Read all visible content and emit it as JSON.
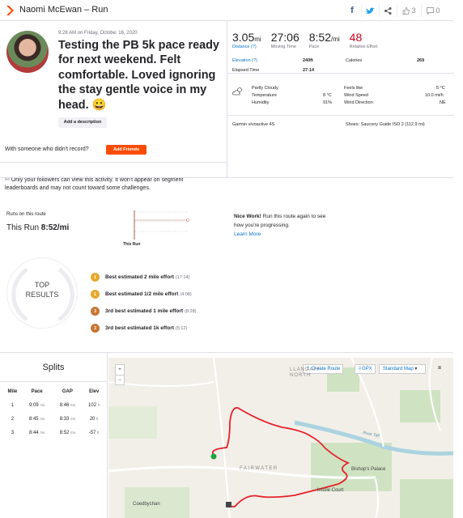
{
  "header": {
    "title": "Naomi McEwan – Run",
    "kudos_count": "3",
    "comment_count": "0"
  },
  "activity": {
    "meta": "9:28 AM on Friday, Octobe: 16, 2020",
    "title": "Testing the PB 5k pace ready for next weekend. Felt comfortable. Loved ignoring the stay gentle voice in my head.",
    "emoji": "😀",
    "add_description_label": "Add a description",
    "with_someone_text": "With someone who didn't record?",
    "add_friends_label": "Add Friends",
    "privacy_text": "Only your followers can view this activity. It won't appear on segment leaderboards and may not count toward some challenges."
  },
  "stats": {
    "distance_value": "3.05",
    "distance_unit": "mi",
    "distance_label": "Distance (?)",
    "moving_time_value": "27:06",
    "moving_time_label": "Moving Time",
    "pace_value": "8:52",
    "pace_unit": "/mi",
    "pace_label": "Pace",
    "relative_effort_value": "48",
    "relative_effort_label": "Relative Effort",
    "elevation_label": "Elevation (?)",
    "elevation_value": "240ft",
    "calories_label": "Calories",
    "calories_value": "269",
    "elapsed_label": "Elapsed Time",
    "elapsed_value": "27:14",
    "weather_condition": "Partly Cloudy",
    "temperature_label": "Temperature",
    "temperature_value": "8 °C",
    "humidity_label": "Humidity",
    "humidity_value": "91%",
    "feels_like_label": "Feels like",
    "feels_like_value": "5 °C",
    "wind_speed_label": "Wind Speed",
    "wind_speed_value": "10.0 mi/h",
    "wind_direction_label": "Wind Direction",
    "wind_direction_value": "NE",
    "device": "Garmin vívoactive 4S",
    "shoes": "Shoes: Saucony Guide ISO 2 (112.9 mi)"
  },
  "route": {
    "label": "Runs on this route",
    "this_run_label": "This Run",
    "this_run_pace": "8:52/mi",
    "chart_tag": "This Run",
    "nice_work_bold": "Nice Work!",
    "nice_work_text": " Run this route again to see how you're progressing.",
    "learn_more": "Learn More"
  },
  "top_results": {
    "label_line1": "TOP",
    "label_line2": "RESULTS",
    "efforts": [
      {
        "name": "Best estimated 2 mile effort",
        "time": "(17:14)",
        "medal": "1",
        "color": "#e6a82f"
      },
      {
        "name": "Best estimated 1/2 mile effort",
        "time": "(4:08)",
        "medal": "1",
        "color": "#e6a82f"
      },
      {
        "name": "3rd best estimated 1 mile effort",
        "time": "(8:28)",
        "medal": "3",
        "color": "#c87533"
      },
      {
        "name": "3rd best estimated 1k effort",
        "time": "(5:12)",
        "medal": "3",
        "color": "#c87533"
      }
    ]
  },
  "splits": {
    "title": "Splits",
    "headers": [
      "Mile",
      "Pace",
      "GAP",
      "Elev"
    ],
    "rows": [
      {
        "mile": "1",
        "pace": "9:09",
        "pace_unit": "/mi",
        "gap": "8:46",
        "gap_unit": "/mi",
        "elev": "102",
        "elev_unit": "ft"
      },
      {
        "mile": "2",
        "pace": "8:45",
        "pace_unit": "/mi",
        "gap": "8:33",
        "gap_unit": "/mi",
        "elev": "20",
        "elev_unit": "ft"
      },
      {
        "mile": "3",
        "pace": "8:44",
        "pace_unit": "/mi",
        "gap": "8:52",
        "gap_unit": "/mi",
        "elev": "-57",
        "elev_unit": "ft"
      }
    ]
  },
  "map": {
    "create_route": "Create Route",
    "gpx": "GPX",
    "map_type": "Standard Map",
    "zoom_in": "+",
    "zoom_out": "−",
    "labels": {
      "llandaff": "LLANDAFF NORTH",
      "fairwater": "FAIRWATER",
      "bishops_palace": "Bishop's Palace",
      "insole_court": "Insole Court",
      "coedbychan": "Coedbychan",
      "river_taff": "River Taff"
    },
    "route_color": "#e8202a"
  },
  "colors": {
    "brand": "#fc4c02",
    "link": "#0d71c4",
    "relative_effort": "#d0021b"
  }
}
